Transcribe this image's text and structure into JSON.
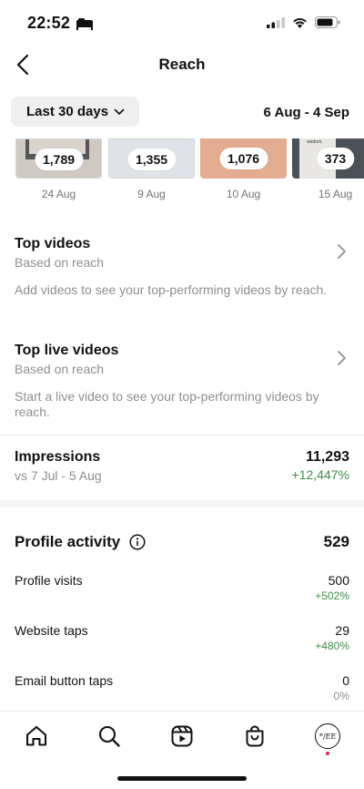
{
  "status": {
    "time": "22:52"
  },
  "header": {
    "title": "Reach"
  },
  "filter": {
    "range_label": "Last 30 days",
    "dates": "6 Aug - 4 Sep"
  },
  "thumbnails": [
    {
      "count": "1,789",
      "date": "24 Aug",
      "bg": "#cfc9c1"
    },
    {
      "count": "1,355",
      "date": "9 Aug",
      "bg": "#dfe3e7"
    },
    {
      "count": "1,076",
      "date": "10 Aug",
      "bg": "#e3ab90"
    },
    {
      "count": "373",
      "date": "15 Aug",
      "bg": "#4b5158"
    }
  ],
  "thumb_brand_text": "wedom.",
  "top_videos": {
    "title": "Top videos",
    "subtitle": "Based on reach",
    "desc": "Add videos to see your top-performing videos by reach."
  },
  "top_live": {
    "title": "Top live videos",
    "subtitle": "Based on reach",
    "desc": "Start a live video to see your top-performing videos by reach."
  },
  "impressions": {
    "title": "Impressions",
    "compare": "vs 7 Jul - 5 Aug",
    "value": "11,293",
    "change": "+12,447%"
  },
  "profile_activity": {
    "title": "Profile activity",
    "total": "529",
    "rows": [
      {
        "label": "Profile visits",
        "value": "500",
        "change": "+502%"
      },
      {
        "label": "Website taps",
        "value": "29",
        "change": "+480%"
      },
      {
        "label": "Email button taps",
        "value": "0",
        "change": "0%"
      }
    ]
  },
  "avatar_text": "*/EE",
  "colors": {
    "positive": "#3e8f48",
    "muted": "#8e8e8e",
    "accent_dot": "#e0245e"
  }
}
